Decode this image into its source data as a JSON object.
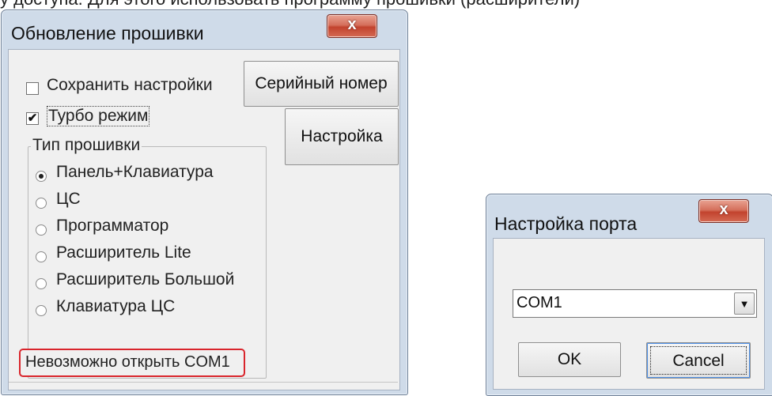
{
  "background_caption": "у доступа. Для этого использовать программу прошивки (расширители)",
  "firmware_window": {
    "title": "Обновление прошивки",
    "close_glyph": "x",
    "save_settings": {
      "label": "Сохранить настройки",
      "checked": false
    },
    "turbo_mode": {
      "label": "Турбо режим",
      "checked": true,
      "check_glyph": "✔"
    },
    "serial_button": "Серийный номер",
    "settings_button": "Настройка",
    "firmware_type": {
      "label": "Тип прошивки",
      "options": [
        {
          "label": "Панель+Клавиатура",
          "selected": true
        },
        {
          "label": "ЦС",
          "selected": false
        },
        {
          "label": "Программатор",
          "selected": false
        },
        {
          "label": "Расширитель Lite",
          "selected": false
        },
        {
          "label": "Расширитель Большой",
          "selected": false
        },
        {
          "label": "Клавиатура ЦС",
          "selected": false
        }
      ]
    },
    "status_text": "Невозможно открыть COM1",
    "highlight_color": "#d9252c"
  },
  "port_window": {
    "title": "Настройка порта",
    "close_glyph": "x",
    "port_value": "COM1",
    "dropdown_glyph": "▼",
    "ok_button": "OK",
    "cancel_button": "Cancel"
  }
}
